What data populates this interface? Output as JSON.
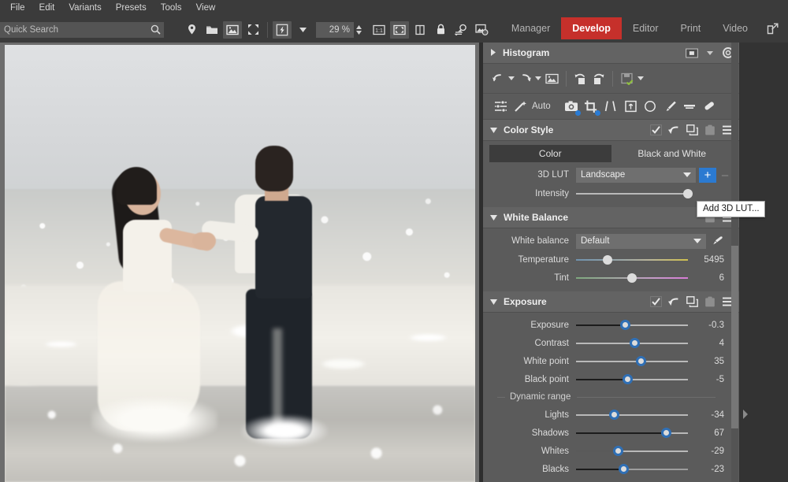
{
  "app": {
    "accent": "#c6302b",
    "panel_bg": "#5b5b5b",
    "toolbar_bg": "#3b3b3b"
  },
  "menubar": {
    "items": [
      {
        "label": "File"
      },
      {
        "label": "Edit"
      },
      {
        "label": "Variants"
      },
      {
        "label": "Presets"
      },
      {
        "label": "Tools"
      },
      {
        "label": "View"
      }
    ]
  },
  "toolbar": {
    "search": {
      "placeholder": "Quick Search",
      "value": "",
      "icon": "search-icon"
    },
    "buttons": [
      {
        "name": "location-pin-icon",
        "active": false
      },
      {
        "name": "open-folder-icon",
        "active": false
      },
      {
        "name": "image-preview-icon",
        "active": true
      },
      {
        "name": "fit-expand-icon",
        "active": false
      },
      {
        "name": "lightning-icon",
        "active": true
      },
      {
        "name": "chevron-down-icon",
        "active": false
      }
    ],
    "zoom": {
      "value": "29 %",
      "stepper": "zoom-stepper"
    },
    "view_buttons": [
      {
        "name": "one-to-one-icon",
        "label": "1:1",
        "active": false
      },
      {
        "name": "fit-to-screen-icon",
        "active": true
      },
      {
        "name": "compare-split-icon",
        "active": false
      },
      {
        "name": "lock-icon",
        "active": false
      },
      {
        "name": "pan-zoom-icon",
        "active": false
      },
      {
        "name": "image-settings-icon",
        "active": false
      }
    ]
  },
  "modes": {
    "items": [
      {
        "label": "Manager",
        "active": false
      },
      {
        "label": "Develop",
        "active": true
      },
      {
        "label": "Editor",
        "active": false
      },
      {
        "label": "Print",
        "active": false
      },
      {
        "label": "Video",
        "active": false
      }
    ],
    "external_icon": "open-external-icon"
  },
  "viewer": {
    "photo_alt": "Bride and groom holding hands in shallow ocean surf"
  },
  "panels": {
    "histogram": {
      "title": "Histogram",
      "collapsed": true,
      "icons": [
        {
          "name": "clipping-preview-icon"
        },
        {
          "name": "chevron-down-icon"
        },
        {
          "name": "gear-icon"
        }
      ]
    },
    "history_toolbar": {
      "buttons": [
        {
          "name": "undo-icon"
        },
        {
          "name": "undo-dropdown-icon"
        },
        {
          "name": "redo-icon"
        },
        {
          "name": "redo-dropdown-icon"
        },
        {
          "name": "reset-image-icon"
        },
        {
          "name": "rotate-left-icon"
        },
        {
          "name": "rotate-right-icon"
        },
        {
          "name": "save-preset-icon"
        },
        {
          "name": "save-dropdown-icon"
        }
      ]
    },
    "tools": {
      "auto_label": "Auto",
      "buttons": [
        {
          "name": "adjustments-icon"
        },
        {
          "name": "magic-wand-icon"
        },
        {
          "name": "white-balance-picker-icon",
          "badge": true
        },
        {
          "name": "crop-icon",
          "badge": true
        },
        {
          "name": "keystone-icon"
        },
        {
          "name": "rotate-frame-icon"
        },
        {
          "name": "radial-mask-icon"
        },
        {
          "name": "brush-icon"
        },
        {
          "name": "gradient-mask-icon"
        },
        {
          "name": "spot-removal-icon"
        }
      ]
    },
    "color_style": {
      "title": "Color Style",
      "expanded": true,
      "header_icons": [
        {
          "name": "enable-checkbox-icon"
        },
        {
          "name": "reset-arrow-icon"
        },
        {
          "name": "copy-icon"
        },
        {
          "name": "paste-icon"
        },
        {
          "name": "menu-hamburger-icon"
        }
      ],
      "segments": [
        {
          "label": "Color",
          "active": true
        },
        {
          "label": "Black and White",
          "active": false
        }
      ],
      "lut": {
        "label": "3D LUT",
        "value": "Landscape",
        "add_button": "+",
        "remove_button": "–"
      },
      "intensity": {
        "label": "Intensity",
        "value": 100,
        "pos": 100
      }
    },
    "tooltip": {
      "text": "Add 3D LUT..."
    },
    "white_balance": {
      "title": "White Balance",
      "expanded": true,
      "header_icons": [
        {
          "name": "paste-icon"
        },
        {
          "name": "menu-hamburger-icon"
        }
      ],
      "mode": {
        "label": "White balance",
        "value": "Default"
      },
      "picker_icon": "eyedropper-icon",
      "sliders": [
        {
          "label": "Temperature",
          "value": "5495",
          "pos": 28,
          "track": "temp"
        },
        {
          "label": "Tint",
          "value": "6",
          "pos": 50,
          "track": "tint"
        }
      ]
    },
    "exposure": {
      "title": "Exposure",
      "expanded": true,
      "header_icons": [
        {
          "name": "enable-checkbox-icon"
        },
        {
          "name": "reset-arrow-icon"
        },
        {
          "name": "copy-icon"
        },
        {
          "name": "paste-icon"
        },
        {
          "name": "menu-hamburger-icon"
        }
      ],
      "sliders": [
        {
          "label": "Exposure",
          "value": "-0.3",
          "pos": 44,
          "track": "darkleft"
        },
        {
          "label": "Contrast",
          "value": "4",
          "pos": 52,
          "track": "plain"
        },
        {
          "label": "White point",
          "value": "35",
          "pos": 58,
          "track": "plain"
        },
        {
          "label": "Black point",
          "value": "-5",
          "pos": 46,
          "track": "darkleft"
        }
      ],
      "dynamic_range": {
        "label": "Dynamic range",
        "sliders": [
          {
            "label": "Lights",
            "value": "-34",
            "pos": 34,
            "track": "plain"
          },
          {
            "label": "Shadows",
            "value": "67",
            "pos": 80,
            "track": "darkleft"
          },
          {
            "label": "Whites",
            "value": "-29",
            "pos": 37,
            "track": "plain"
          },
          {
            "label": "Blacks",
            "value": "-23",
            "pos": 42,
            "track": "darkleft"
          }
        ]
      }
    }
  },
  "scroll": {
    "name": "panel-vertical-scrollbar"
  },
  "collapse": {
    "name": "panel-collapse-arrow-icon"
  }
}
